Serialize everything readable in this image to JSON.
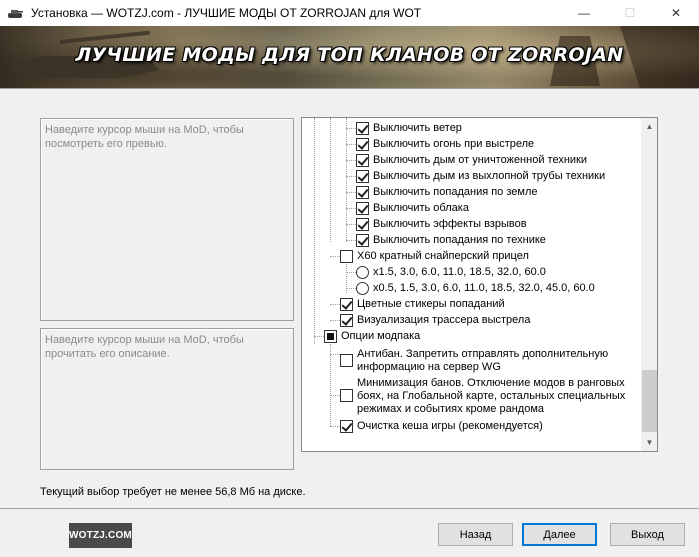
{
  "window": {
    "title": "Установка — WOTZJ.com - ЛУЧШИЕ МОДЫ ОТ ZORROJAN для WOT",
    "minimize_glyph": "—",
    "maximize_glyph": "☐",
    "close_glyph": "✕"
  },
  "banner": {
    "title": "ЛУЧШИЕ МОДЫ ДЛЯ ТОП КЛАНОВ ОТ ZORROJAN"
  },
  "panes": {
    "preview_text": "Наведите курсор мыши на МоD, чтобы посмотреть его превью.",
    "description_text": "Наведите курсор мыши на МоD, чтобы прочитать его описание."
  },
  "tree": {
    "items": [
      {
        "label": "Выключить ветер",
        "state": "checked"
      },
      {
        "label": "Выключить огонь при выстреле",
        "state": "checked"
      },
      {
        "label": "Выключить дым от уничтоженной техники",
        "state": "checked"
      },
      {
        "label": "Выключить дым из выхлопной трубы техники",
        "state": "checked"
      },
      {
        "label": "Выключить попадания по земле",
        "state": "checked"
      },
      {
        "label": "Выключить облака",
        "state": "checked"
      },
      {
        "label": "Выключить эффекты взрывов",
        "state": "checked"
      },
      {
        "label": "Выключить попадания по технике",
        "state": "checked"
      },
      {
        "label": "X60 кратный снайперский прицел",
        "state": "unchecked"
      },
      {
        "label": "x1.5, 3.0, 6.0, 11.0, 18.5, 32.0, 60.0",
        "state": "radio"
      },
      {
        "label": "x0.5, 1.5, 3.0, 6.0, 11.0, 18.5, 32.0, 45.0, 60.0",
        "state": "radio"
      },
      {
        "label": "Цветные стикеры попаданий",
        "state": "checked"
      },
      {
        "label": "Визуализация трассера выстрела",
        "state": "checked"
      },
      {
        "label": "Опции модпака",
        "state": "partial"
      },
      {
        "label": "Антибан. Запретить отправлять дополнительную информацию на сервер WG",
        "state": "unchecked"
      },
      {
        "label": "Минимизация банов. Отключение модов в ранговых боях, на Глобальной карте, остальных специальных режимах и событиях кроме рандома",
        "state": "unchecked"
      },
      {
        "label": "Очистка кеша игры (рекомендуется)",
        "state": "checked"
      }
    ]
  },
  "status": {
    "text": "Текущий выбор требует не менее 56,8 Мб на диске."
  },
  "logo": {
    "text": "WOTZJ.COM"
  },
  "buttons": {
    "back": "Назад",
    "next": "Далее",
    "exit": "Выход"
  }
}
